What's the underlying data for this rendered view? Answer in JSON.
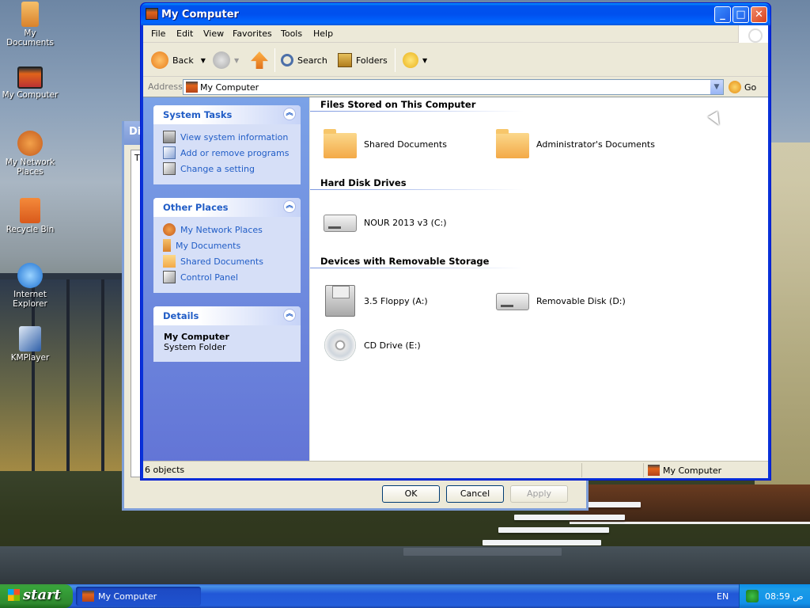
{
  "desktop": {
    "icons": [
      {
        "label": "My Documents",
        "icon": "folder-documents-icon"
      },
      {
        "label": "My Computer",
        "icon": "computer-icon"
      },
      {
        "label": "My Network Places",
        "icon": "network-icon"
      },
      {
        "label": "Recycle Bin",
        "icon": "recycle-bin-icon"
      },
      {
        "label": "Internet Explorer",
        "icon": "internet-explorer-icon"
      },
      {
        "label": "KMPlayer",
        "icon": "kmplayer-icon"
      }
    ]
  },
  "background_dialog": {
    "title_partial": "Dis",
    "tab_partial": "T",
    "buttons": {
      "ok": "OK",
      "cancel": "Cancel",
      "apply": "Apply"
    }
  },
  "window": {
    "title": "My Computer",
    "menu": [
      "File",
      "Edit",
      "View",
      "Favorites",
      "Tools",
      "Help"
    ],
    "toolbar": {
      "back": "Back",
      "search": "Search",
      "folders": "Folders"
    },
    "address": {
      "label": "Address",
      "value": "My Computer",
      "go": "Go"
    },
    "task_pane": {
      "system_tasks": {
        "title": "System Tasks",
        "items": [
          "View system information",
          "Add or remove programs",
          "Change a setting"
        ]
      },
      "other_places": {
        "title": "Other Places",
        "items": [
          "My Network Places",
          "My Documents",
          "Shared Documents",
          "Control Panel"
        ]
      },
      "details": {
        "title": "Details",
        "name": "My Computer",
        "type": "System Folder"
      }
    },
    "groups": {
      "files_stored": {
        "title": "Files Stored on This Computer",
        "items": [
          "Shared Documents",
          "Administrator's Documents"
        ]
      },
      "hard_disks": {
        "title": "Hard Disk Drives",
        "items": [
          "NOUR 2013 v3 (C:)"
        ]
      },
      "removable": {
        "title": "Devices with Removable Storage",
        "items": [
          "3.5 Floppy (A:)",
          "Removable Disk (D:)",
          "CD Drive (E:)"
        ]
      }
    },
    "status": {
      "count": "6 objects",
      "location": "My Computer"
    }
  },
  "taskbar": {
    "start": "start",
    "task_button": "My Computer",
    "language": "EN",
    "clock": "08:59 ص"
  },
  "colors": {
    "title_blue": "#0053ee",
    "task_link": "#215dc6",
    "taskbar_blue": "#245edb",
    "start_green": "#37a33a"
  }
}
